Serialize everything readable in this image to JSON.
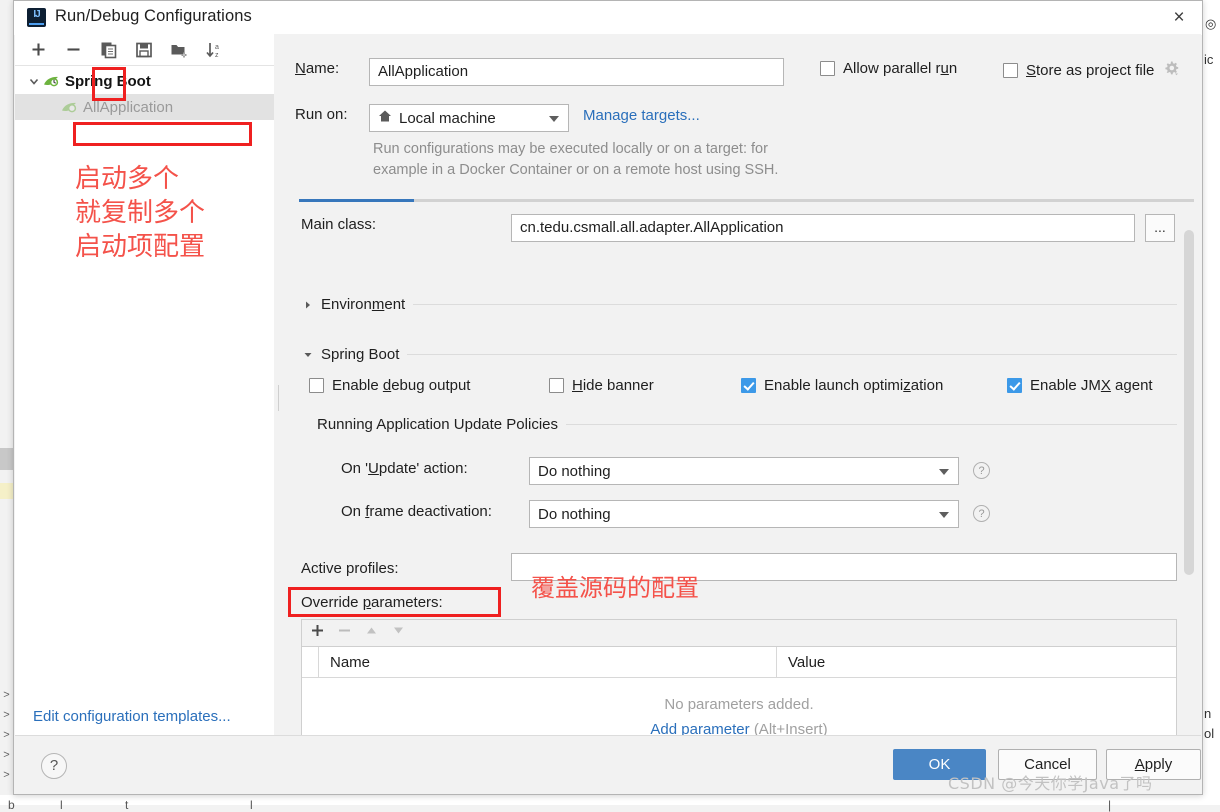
{
  "window": {
    "title": "Run/Debug Configurations",
    "close_label": "×",
    "app_icon": "intellij-idea-icon"
  },
  "left_panel": {
    "toolbar": [
      {
        "name": "add-configuration-button",
        "icon": "plus-icon",
        "label": "+"
      },
      {
        "name": "remove-configuration-button",
        "icon": "minus-icon",
        "label": "−"
      },
      {
        "name": "copy-configuration-button",
        "icon": "copy-icon",
        "label": "Copy Configuration",
        "highlighted": true
      },
      {
        "name": "save-configuration-button",
        "icon": "save-icon",
        "label": "Save Configuration"
      },
      {
        "name": "new-folder-button",
        "icon": "new-folder-icon",
        "label": "New Folder"
      },
      {
        "name": "sort-configurations-button",
        "icon": "sort-alpha-icon",
        "label": "Sort Configurations"
      }
    ],
    "tree": [
      {
        "label": "Spring Boot",
        "type": "group",
        "expanded": true,
        "icon": "spring-boot-icon"
      },
      {
        "label": "AllApplication",
        "type": "child",
        "selected": true,
        "icon": "spring-boot-icon"
      }
    ],
    "annotation_cn": "启动多个\n就复制多个\n启动项配置",
    "edit_templates_link": "Edit configuration templates..."
  },
  "form": {
    "name_label": "Name:",
    "name_value": "AllApplication",
    "allow_parallel_run": {
      "label": "Allow parallel run",
      "checked": false
    },
    "store_as_project_file": {
      "label": "Store as project file",
      "checked": false,
      "gear_icon": "gear-icon"
    },
    "run_on_label": "Run on:",
    "run_on_value": "Local machine",
    "run_on_icon": "home-icon",
    "manage_targets_link": "Manage targets...",
    "hint_line1": "Run configurations may be executed locally or on a target: for",
    "hint_line2": "example in a Docker Container or on a remote host using SSH.",
    "main_class_label": "Main class:",
    "main_class_value": "cn.tedu.csmall.all.adapter.AllApplication",
    "browse_button_label": "...",
    "environment_section": "Environment",
    "spring_boot_section": "Spring Boot",
    "enable_debug_output": {
      "label": "Enable debug output",
      "checked": false
    },
    "hide_banner": {
      "label": "Hide banner",
      "checked": false
    },
    "enable_launch_optimization": {
      "label": "Enable launch optimization",
      "checked": true
    },
    "enable_jmx_agent": {
      "label": "Enable JMX agent",
      "checked": true
    },
    "update_policies_section": "Running Application Update Policies",
    "on_update_action_label": "On 'Update' action:",
    "on_update_action_value": "Do nothing",
    "on_frame_deactivation_label": "On frame deactivation:",
    "on_frame_deactivation_value": "Do nothing",
    "active_profiles_label": "Active profiles:",
    "active_profiles_value": "",
    "override_parameters_label": "Override parameters:",
    "annotation_cn": "覆盖源码的配置",
    "help_icon": "help-icon"
  },
  "params_table": {
    "toolbar": [
      {
        "name": "add-parameter-button",
        "icon": "plus-icon",
        "label": "+"
      },
      {
        "name": "remove-parameter-button",
        "icon": "minus-icon",
        "label": "−"
      },
      {
        "name": "move-up-button",
        "icon": "arrow-up-icon",
        "label": "▲"
      },
      {
        "name": "move-down-button",
        "icon": "arrow-down-icon",
        "label": "▼"
      }
    ],
    "columns": [
      "Name",
      "Value"
    ],
    "rows": [],
    "empty_text": "No parameters added.",
    "empty_link": "Add parameter",
    "empty_shortcut": "(Alt+Insert)"
  },
  "footer": {
    "help_label": "?",
    "ok_label": "OK",
    "cancel_label": "Cancel",
    "apply_label": "Apply"
  },
  "watermark": "CSDN @今天你学Java了吗",
  "colors": {
    "accent_blue": "#3777bc",
    "primary_button": "#4a86c5",
    "checkbox_on": "#3c99e8",
    "link": "#2a6fbb",
    "annotation_red": "#f4524a",
    "highlight_box_red": "#ef2020"
  }
}
